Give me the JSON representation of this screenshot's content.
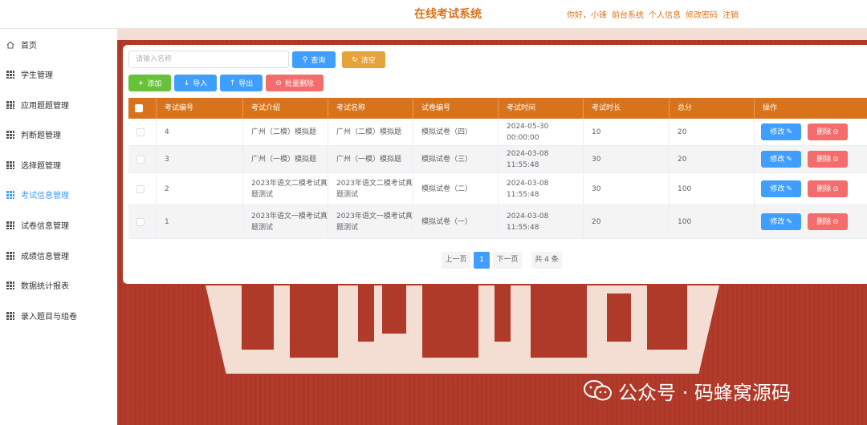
{
  "header": {
    "title": "在线考试系统",
    "greeting": "你好，小锋",
    "links": [
      "前台系统",
      "个人信息",
      "修改密码",
      "注销"
    ]
  },
  "sidebar": {
    "items": [
      {
        "label": "首页",
        "icon": "home-icon"
      },
      {
        "label": "学生管理",
        "icon": "grid-icon"
      },
      {
        "label": "应用题题管理",
        "icon": "grid-icon"
      },
      {
        "label": "判断题管理",
        "icon": "grid-icon"
      },
      {
        "label": "选择题管理",
        "icon": "grid-icon"
      },
      {
        "label": "考试信息管理",
        "icon": "grid-icon",
        "active": true
      },
      {
        "label": "试卷信息管理",
        "icon": "grid-icon"
      },
      {
        "label": "成绩信息管理",
        "icon": "grid-icon"
      },
      {
        "label": "数据统计报表",
        "icon": "grid-icon"
      },
      {
        "label": "录入题目与组卷",
        "icon": "grid-icon"
      }
    ]
  },
  "toolbar": {
    "search_placeholder": "请输入名称",
    "query_label": "查询",
    "clear_label": "清空",
    "add_label": "添加",
    "import_label": "导入",
    "export_label": "导出",
    "batch_delete_label": "批量删除"
  },
  "table": {
    "columns": [
      "考试编号",
      "考试介绍",
      "考试名称",
      "试卷编号",
      "考试时间",
      "考试时长",
      "总分",
      "操作"
    ],
    "edit_label": "修改",
    "delete_label": "删除",
    "rows": [
      {
        "id": "4",
        "intro": "广州（二模）模拟题",
        "name": "广州（二模）模拟题",
        "paper": "模拟试卷（四）",
        "time": "2024-05-30 00:00:00",
        "duration": "10",
        "score": "20"
      },
      {
        "id": "3",
        "intro": "广州（一模）模拟题",
        "name": "广州（一模）模拟题",
        "paper": "模拟试卷（三）",
        "time": "2024-03-08 11:55:48",
        "duration": "30",
        "score": "20"
      },
      {
        "id": "2",
        "intro": "2023年语文二模考试真题测试",
        "name": "2023年语文二模考试真题测试",
        "paper": "模拟试卷（二）",
        "time": "2024-03-08 11:55:48",
        "duration": "30",
        "score": "100"
      },
      {
        "id": "1",
        "intro": "2023年语文一模考试真题测试",
        "name": "2023年语文一模考试真题测试",
        "paper": "模拟试卷（一）",
        "time": "2024-03-08 11:55:48",
        "duration": "20",
        "score": "100"
      }
    ]
  },
  "pagination": {
    "prev_label": "上一页",
    "current_page": "1",
    "next_label": "下一页",
    "total_label": "共 4 条"
  },
  "watermark": {
    "text": "公众号 · 码蜂窝源码"
  },
  "colors": {
    "accent": "#d9731b",
    "primary": "#409eff",
    "warning": "#e6a23c",
    "success": "#67c23a",
    "danger": "#f56c6c",
    "background": "#b03a2a"
  }
}
